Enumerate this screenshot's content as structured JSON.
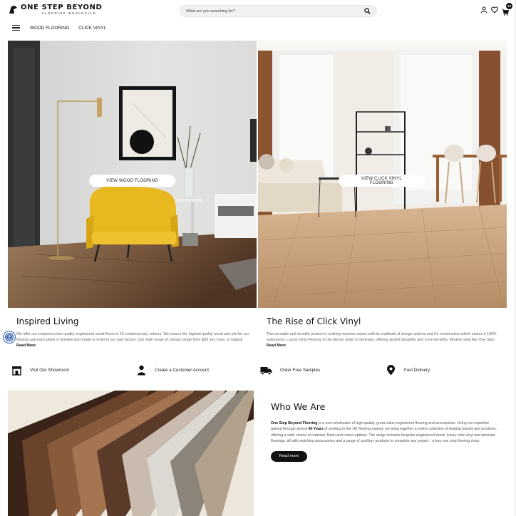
{
  "brand": {
    "name": "ONE STEP BEYOND",
    "tagline": "FLOORING WHOLESALE"
  },
  "search": {
    "placeholder": "What are you searching for?"
  },
  "cart": {
    "count": "12"
  },
  "nav": {
    "items": [
      "WOOD FLOORING",
      "CLICK VINYL"
    ]
  },
  "hero": {
    "left": {
      "button": "VIEW WOOD FLOORING",
      "title": "Inspired Living",
      "body": "We offer our customers two quality engineered wood floors in 15 contemporary colours. We source the highest quality wood and oils for our flooring and each plank is finished and made to order in our own factory. Our wide range of colours range from light airy hues, to natural oaks and sophisticated browns, perfect for both residential and commercial spaces.",
      "read_more": "Read More"
    },
    "right": {
      "button": "VIEW CLICK VINYL FLOORING",
      "title": "The Rise of Click Vinyl",
      "body": "This versatile and durable product is making massive waves with its multitude of design options and it's construction which makes it 100% waterproof. Luxury Vinyl Flooring is the fancier sister to laminate, offering added durability and more benefits. Modern vinyl like One Step Beyond Flooring's click vinyl comes in a multitude of colours and designs with an",
      "read_more": "Read More"
    }
  },
  "features": [
    {
      "icon": "store-icon",
      "label": "Visit Our Showroom"
    },
    {
      "icon": "user-icon",
      "label": "Create a Customer Account"
    },
    {
      "icon": "truck-icon",
      "label": "Order Free Samples"
    },
    {
      "icon": "location-pin-icon",
      "label": "Fast Delivery"
    }
  ],
  "who": {
    "title": "Who We Are",
    "brand_bold": "One Step Beyond Flooring",
    "text_1": " is a new wholesaler of high quality, great value engineered flooring and accessories. Using our expertise gained through almost ",
    "years_bold": "40 Years",
    "text_2": " of working in the UK flooring market, we bring together a select collection of leading brands and products, offering a wide choice of material, finish and colour options. The range includes bespoke engineered wood, luxury click vinyl and laminate floorings, all with matching accessories and a range of ancillary products to complete any project - a true one stop flooring shop.",
    "read_more": "Read more"
  },
  "colors": {
    "accent": "#111111",
    "a11y": "#2b5ba8",
    "yellow_chair": "#e8b820"
  }
}
